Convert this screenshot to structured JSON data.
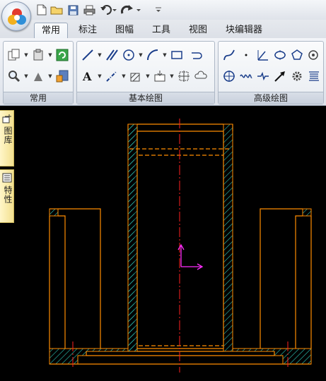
{
  "quick_access": {
    "icons": [
      "new-file-icon",
      "open-folder-icon",
      "save-icon",
      "print-icon",
      "undo-icon",
      "redo-icon",
      "customize-icon"
    ]
  },
  "tabs": [
    {
      "label": "常用",
      "active": true
    },
    {
      "label": "标注",
      "active": false
    },
    {
      "label": "图幅",
      "active": false
    },
    {
      "label": "工具",
      "active": false
    },
    {
      "label": "视图",
      "active": false
    },
    {
      "label": "块编辑器",
      "active": false
    }
  ],
  "ribbon": {
    "groups": [
      {
        "label": "常用"
      },
      {
        "label": "基本绘图"
      },
      {
        "label": "高级绘图"
      }
    ]
  },
  "side_panel": {
    "tab1_label": "图库",
    "tab2_label": "特性"
  },
  "colors": {
    "accent_orange": "#ff8c00",
    "hatch_cyan": "#2ec7b8",
    "centerline_red": "#ff2020",
    "ucs_magenta": "#ff2dff",
    "canvas_bg": "#000000"
  }
}
